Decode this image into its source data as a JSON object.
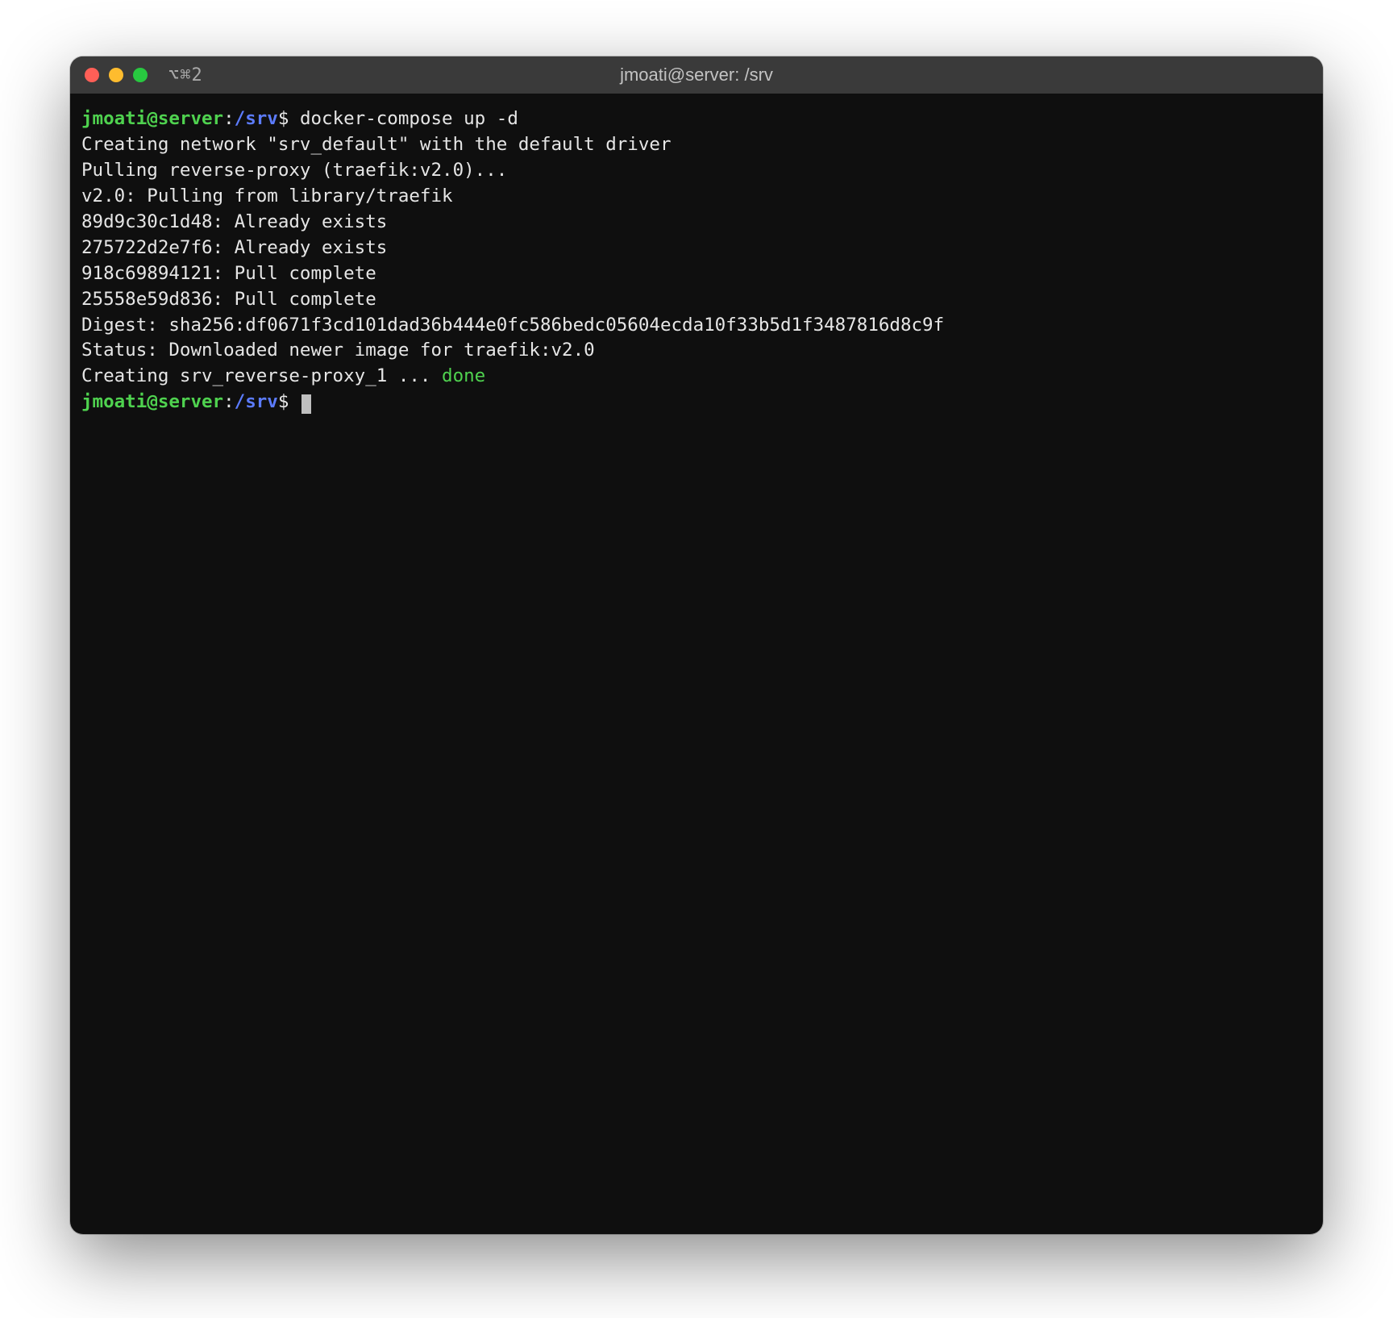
{
  "titlebar": {
    "tab_indicator": "⌥⌘2",
    "title": "jmoati@server: /srv"
  },
  "prompt": {
    "user_host": "jmoati@server",
    "sep": ":",
    "path": "/srv",
    "symbol": "$"
  },
  "session": {
    "command1": "docker-compose up -d",
    "lines": [
      "Creating network \"srv_default\" with the default driver",
      "Pulling reverse-proxy (traefik:v2.0)...",
      "v2.0: Pulling from library/traefik",
      "89d9c30c1d48: Already exists",
      "275722d2e7f6: Already exists",
      "918c69894121: Pull complete",
      "25558e59d836: Pull complete",
      "Digest: sha256:df0671f3cd101dad36b444e0fc586bedc05604ecda10f33b5d1f3487816d8c9f",
      "Status: Downloaded newer image for traefik:v2.0"
    ],
    "creating_prefix": "Creating srv_reverse-proxy_1 ... ",
    "creating_status": "done"
  }
}
